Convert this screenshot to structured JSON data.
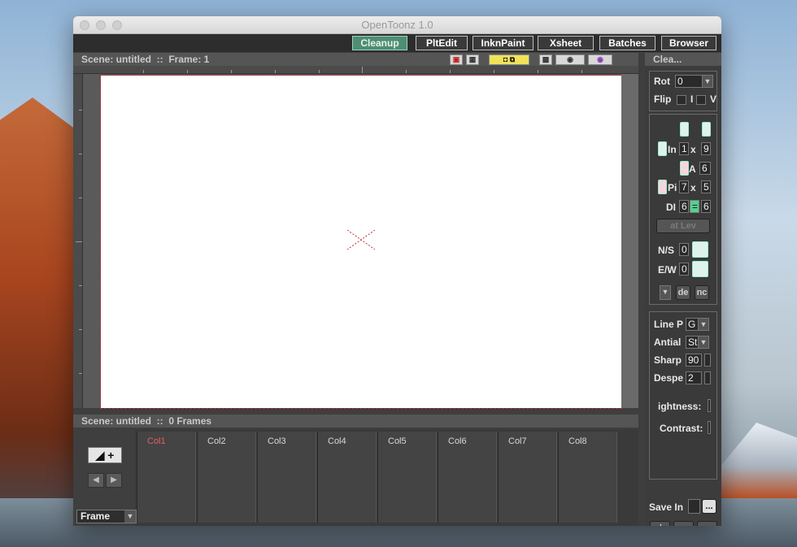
{
  "window": {
    "title": "OpenToonz 1.0"
  },
  "rooms": [
    "Cleanup",
    "PltEdit",
    "InknPaint",
    "Xsheet",
    "Batches",
    "Browser"
  ],
  "viewer": {
    "header": "Scene: untitled  ::  Frame: 1"
  },
  "xsheet": {
    "header": "Scene: untitled  ::  0 Frames",
    "columns": [
      "Col1",
      "Col2",
      "Col3",
      "Col4",
      "Col5",
      "Col6",
      "Col7",
      "Col8"
    ],
    "frame_mode": "Frame",
    "new_column": "+"
  },
  "cleanup": {
    "title": "Clea...",
    "rot_label": "Rot",
    "rot_value": "0",
    "flip_label": "Flip",
    "flip_h": "I",
    "flip_v": "V",
    "in_label": "In",
    "in_w": "1",
    "in_x": "x",
    "in_h": "9",
    "a_label": "A",
    "a_value": "6",
    "pi_label": "Pi",
    "pi_w": "7",
    "pi_x": "x",
    "pi_h": "5",
    "dpi_label": "DI",
    "dpi_a": "6",
    "dpi_b": "6",
    "level_button": "at Lev",
    "ns_label": "N/S",
    "ns_value": "0",
    "ew_label": "E/W",
    "ew_value": "0",
    "btn_a": "de",
    "btn_b": "nc",
    "line_label": "Line P",
    "line_value": "G",
    "antial_label": "Antial",
    "antial_value": "St",
    "sharp_label": "Sharp",
    "sharp_value": "90",
    "despe_label": "Despe",
    "despe_value": "2",
    "brightness_label": "ightness:",
    "contrast_label": "Contrast:",
    "save_in_label": "Save In",
    "browse": "...",
    "bottom_buttons": [
      "ı\\",
      "x",
      ":s"
    ]
  }
}
